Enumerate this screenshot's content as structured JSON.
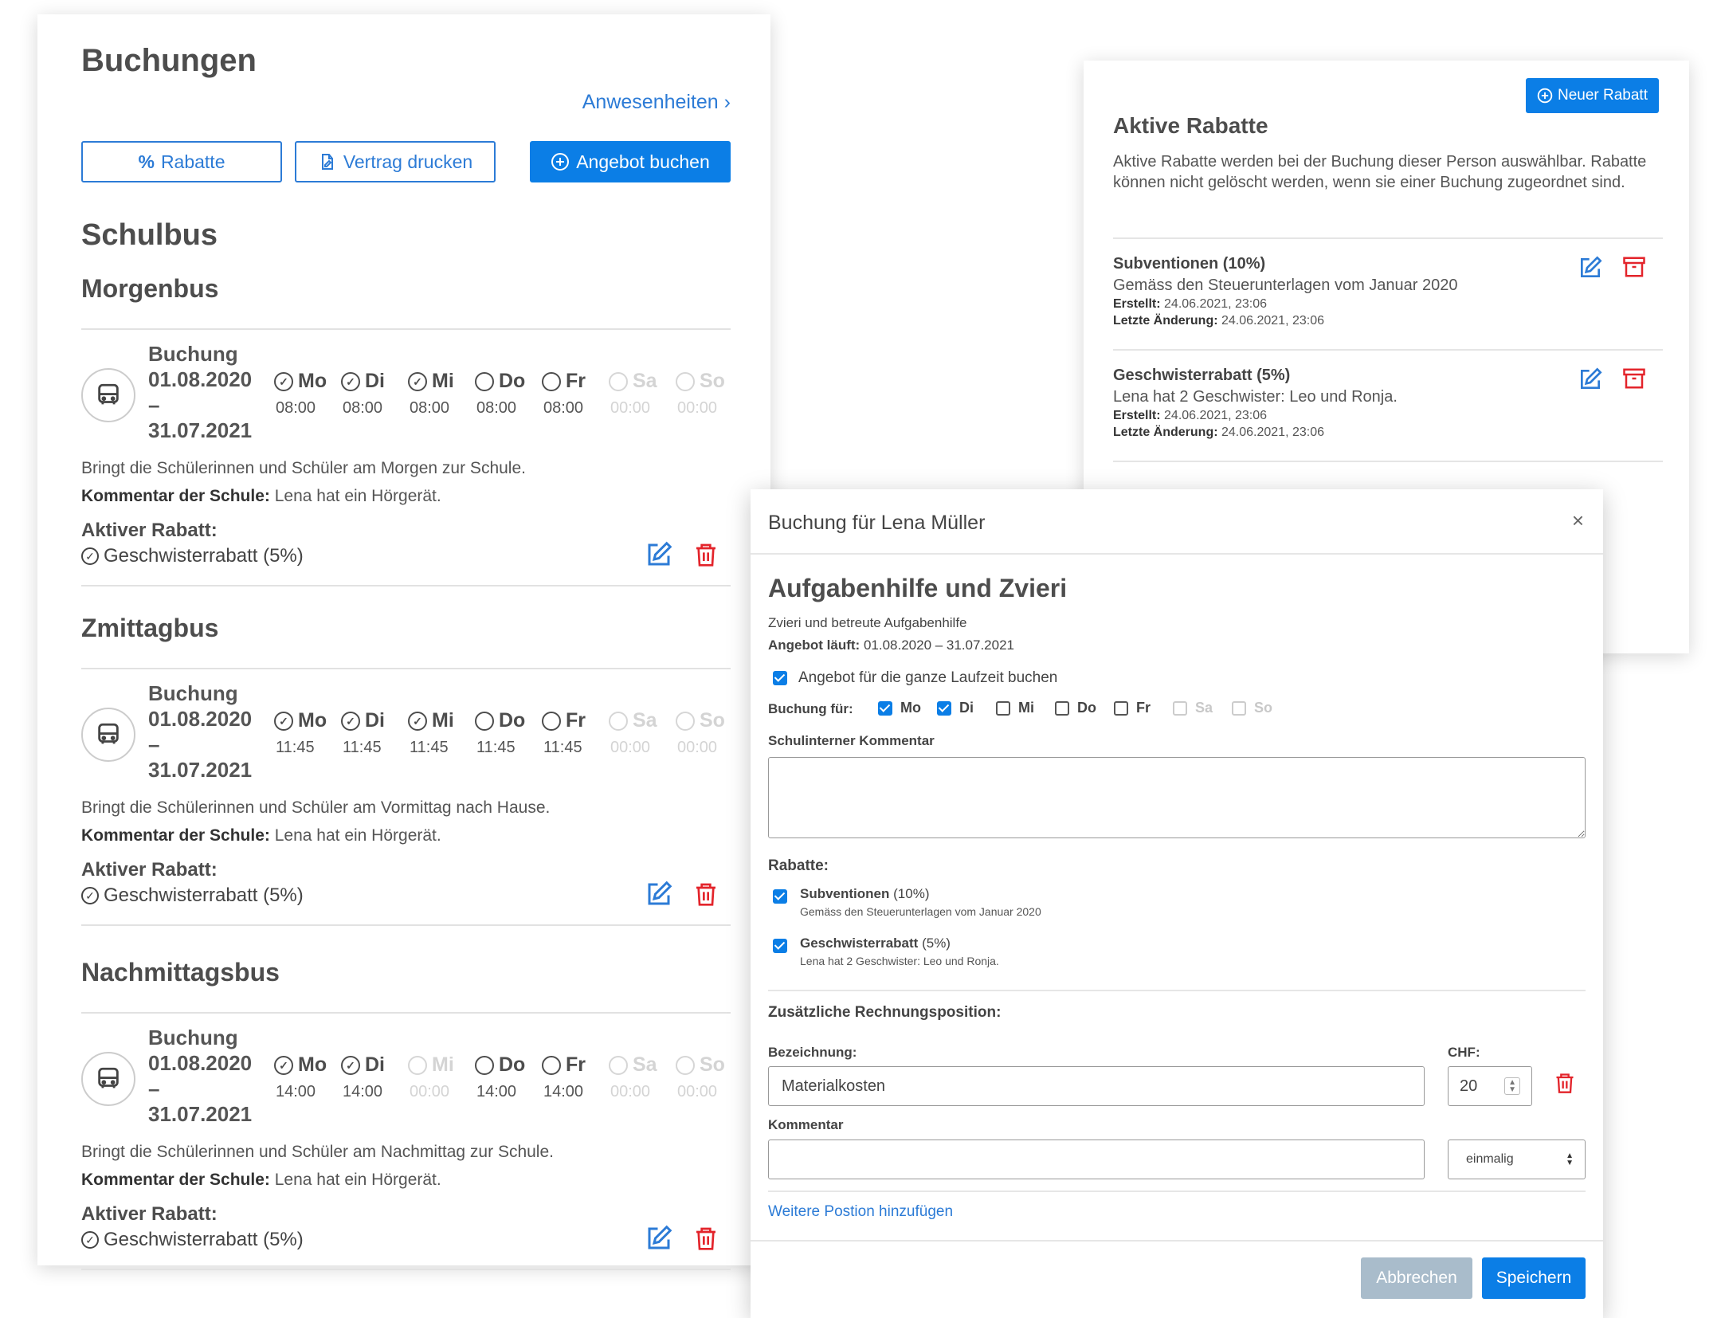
{
  "bookings": {
    "title": "Buchungen",
    "attendance_link": "Anwesenheiten",
    "buttons": {
      "discounts": "Rabatte",
      "print": "Vertrag drucken",
      "book": "Angebot buchen"
    },
    "category": "Schulbus",
    "sections": [
      {
        "title": "Morgenbus",
        "label": "Buchung",
        "from": "01.08.2020",
        "dash": "–",
        "to": "31.07.2021",
        "days": [
          {
            "name": "Mo",
            "time": "08:00",
            "active": true
          },
          {
            "name": "Di",
            "time": "08:00",
            "active": true
          },
          {
            "name": "Mi",
            "time": "08:00",
            "active": true
          },
          {
            "name": "Do",
            "time": "08:00",
            "active": false
          },
          {
            "name": "Fr",
            "time": "08:00",
            "active": false
          },
          {
            "name": "Sa",
            "time": "00:00",
            "active": false,
            "disabled": true
          },
          {
            "name": "So",
            "time": "00:00",
            "active": false,
            "disabled": true
          }
        ],
        "description": "Bringt die Schülerinnen und Schüler am Morgen zur Schule.",
        "comment_label": "Kommentar der Schule:",
        "comment": "Lena hat ein Hörgerät.",
        "discount_label": "Aktiver Rabatt:",
        "discount": "Geschwisterrabatt (5%)"
      },
      {
        "title": "Zmittagbus",
        "label": "Buchung",
        "from": "01.08.2020",
        "dash": "–",
        "to": "31.07.2021",
        "days": [
          {
            "name": "Mo",
            "time": "11:45",
            "active": true
          },
          {
            "name": "Di",
            "time": "11:45",
            "active": true
          },
          {
            "name": "Mi",
            "time": "11:45",
            "active": true
          },
          {
            "name": "Do",
            "time": "11:45",
            "active": false
          },
          {
            "name": "Fr",
            "time": "11:45",
            "active": false
          },
          {
            "name": "Sa",
            "time": "00:00",
            "active": false,
            "disabled": true
          },
          {
            "name": "So",
            "time": "00:00",
            "active": false,
            "disabled": true
          }
        ],
        "description": "Bringt die Schülerinnen und Schüler am Vormittag nach Hause.",
        "comment_label": "Kommentar der Schule:",
        "comment": "Lena hat ein Hörgerät.",
        "discount_label": "Aktiver Rabatt:",
        "discount": "Geschwisterrabatt (5%)"
      },
      {
        "title": "Nachmittagsbus",
        "label": "Buchung",
        "from": "01.08.2020",
        "dash": "–",
        "to": "31.07.2021",
        "days": [
          {
            "name": "Mo",
            "time": "14:00",
            "active": true
          },
          {
            "name": "Di",
            "time": "14:00",
            "active": true
          },
          {
            "name": "Mi",
            "time": "00:00",
            "active": false,
            "disabled": true
          },
          {
            "name": "Do",
            "time": "14:00",
            "active": false
          },
          {
            "name": "Fr",
            "time": "14:00",
            "active": false
          },
          {
            "name": "Sa",
            "time": "00:00",
            "active": false,
            "disabled": true
          },
          {
            "name": "So",
            "time": "00:00",
            "active": false,
            "disabled": true
          }
        ],
        "description": "Bringt die Schülerinnen und Schüler am Nachmittag zur Schule.",
        "comment_label": "Kommentar der Schule:",
        "comment": "Lena hat ein Hörgerät.",
        "discount_label": "Aktiver Rabatt:",
        "discount": "Geschwisterrabatt (5%)"
      }
    ]
  },
  "discounts_panel": {
    "new_button": "Neuer Rabatt",
    "title": "Aktive Rabatte",
    "intro": "Aktive Rabatte werden bei der Buchung dieser Person auswählbar. Rabatte können nicht gelöscht werden, wenn sie einer Buchung zugeordnet sind.",
    "items": [
      {
        "name": "Subventionen (10%)",
        "description": "Gemäss den Steuerunterlagen vom Januar 2020",
        "created_label": "Erstellt:",
        "created": "24.06.2021, 23:06",
        "changed_label": "Letzte Änderung:",
        "changed": "24.06.2021, 23:06"
      },
      {
        "name": "Geschwisterrabatt (5%)",
        "description": "Lena hat 2 Geschwister: Leo und Ronja.",
        "created_label": "Erstellt:",
        "created": "24.06.2021, 23:06",
        "changed_label": "Letzte Änderung:",
        "changed": "24.06.2021, 23:06"
      }
    ]
  },
  "modal": {
    "title": "Buchung für Lena Müller",
    "close": "×",
    "offer_title": "Aufgabenhilfe und Zvieri",
    "offer_subtitle": "Zvieri und betreute Aufgabenhilfe",
    "runtime_label": "Angebot läuft:",
    "runtime": "01.08.2020 – 31.07.2021",
    "whole_period": "Angebot für die ganze Laufzeit buchen",
    "booking_for_label": "Buchung für:",
    "weekdays": [
      {
        "name": "Mo",
        "checked": true
      },
      {
        "name": "Di",
        "checked": true
      },
      {
        "name": "Mi",
        "checked": false
      },
      {
        "name": "Do",
        "checked": false
      },
      {
        "name": "Fr",
        "checked": false
      },
      {
        "name": "Sa",
        "checked": false,
        "disabled": true
      },
      {
        "name": "So",
        "checked": false,
        "disabled": true
      }
    ],
    "comment_label": "Schulinterner Kommentar",
    "comment_value": "",
    "discounts_label": "Rabatte:",
    "discounts": [
      {
        "name": "Subventionen",
        "pct": "(10%)",
        "note": "Gemäss den Steuerunterlagen vom Januar 2020",
        "checked": true
      },
      {
        "name": "Geschwisterrabatt",
        "pct": "(5%)",
        "note": "Lena hat 2 Geschwister: Leo und Ronja.",
        "checked": true
      }
    ],
    "extra_label": "Zusätzliche Rechnungsposition:",
    "desc_label": "Bezeichnung:",
    "desc_value": "Materialkosten",
    "chf_label": "CHF:",
    "chf_value": "20",
    "kommentar_label": "Kommentar",
    "kommentar_value": "",
    "frequency": "einmalig",
    "add_position": "Weitere Postion hinzufügen",
    "cancel": "Abbrechen",
    "save": "Speichern"
  },
  "colors": {
    "primary": "#0b7ee6",
    "link": "#2c7bd6",
    "danger": "#e3242b",
    "cancel": "#a9bccb"
  }
}
